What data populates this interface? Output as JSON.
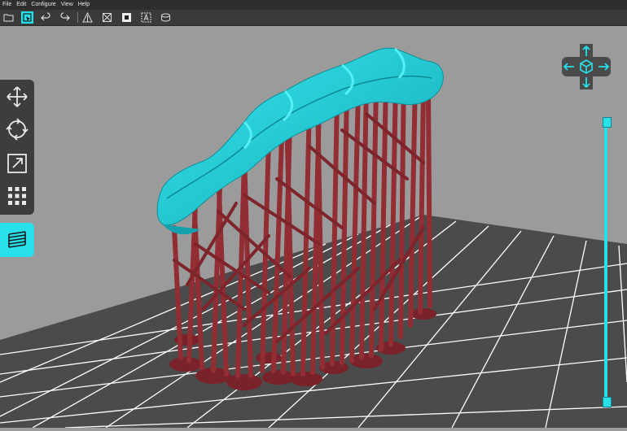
{
  "menu": [
    "File",
    "Edit",
    "Configure",
    "View",
    "Help"
  ],
  "toolbar_icons": [
    "open-file-icon",
    "select-icon",
    "undo-icon",
    "redo-icon",
    "support-icon",
    "no-support-icon",
    "hollow-icon",
    "auto-support-icon",
    "volume-icon"
  ],
  "side_tools": [
    "move-icon",
    "rotate-icon",
    "scale-icon",
    "arrange-icon"
  ],
  "active_tool": "layers-icon",
  "colors": {
    "accent": "#27e0ea",
    "model": "#1fc8d2",
    "supports": "#8e2b31",
    "bed": "#4a4a4a",
    "background": "#9b9b9b"
  }
}
